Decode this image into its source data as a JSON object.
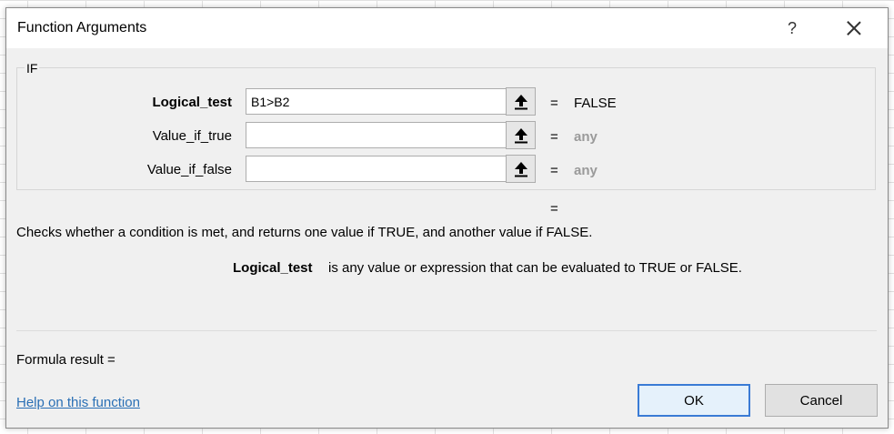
{
  "dialog": {
    "title": "Function Arguments",
    "help_glyph": "?",
    "function_name": "IF"
  },
  "arguments": [
    {
      "label": "Logical_test",
      "value": "B1>B2",
      "result": "FALSE"
    },
    {
      "label": "Value_if_true",
      "value": "",
      "result": "any"
    },
    {
      "label": "Value_if_false",
      "value": "",
      "result": "any"
    }
  ],
  "equals_sign": "=",
  "description": "Checks whether a condition is met, and returns one value if TRUE, and another value if FALSE.",
  "arg_description": {
    "name": "Logical_test",
    "text": "is any value or expression that can be evaluated to TRUE or FALSE."
  },
  "formula_result": "Formula result =",
  "help_link": "Help on this function",
  "buttons": {
    "ok": "OK",
    "cancel": "Cancel"
  },
  "icons": {
    "ref": "collapse-ref-icon",
    "close": "close-icon"
  }
}
